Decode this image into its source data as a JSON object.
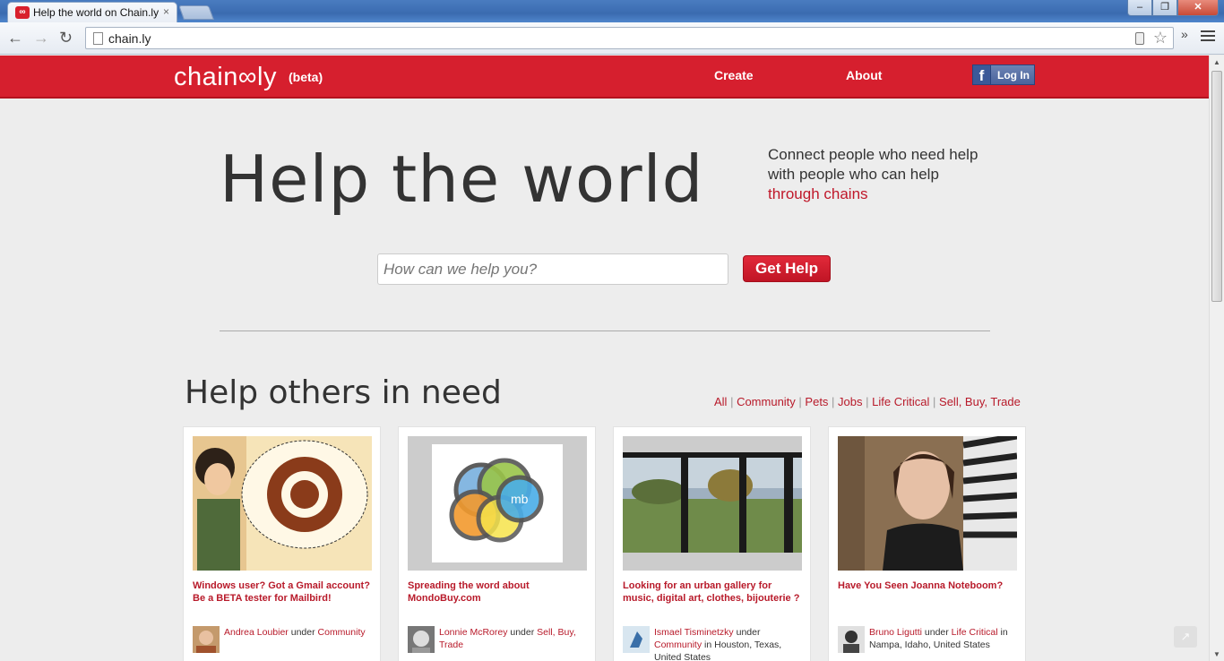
{
  "browser": {
    "tab_title": "Help the world on Chain.ly",
    "tab_favicon_glyph": "∞",
    "url": "chain.ly",
    "close_glyph": "×"
  },
  "header": {
    "logo_text": "chain∞ly",
    "beta": "(beta)",
    "nav": {
      "create": "Create",
      "about": "About"
    },
    "fb_login": "Log In"
  },
  "hero": {
    "title": "Help the world",
    "tagline_line1": "Connect people who need help",
    "tagline_line2": "with people who can help",
    "tagline_accent": "through chains",
    "search_placeholder": "How can we help you?",
    "get_help_label": "Get Help"
  },
  "section": {
    "title": "Help others in need",
    "filters": [
      "All",
      "Community",
      "Pets",
      "Jobs",
      "Life Critical",
      "Sell, Buy, Trade"
    ]
  },
  "cards": [
    {
      "title": "Windows user? Got a Gmail account? Be a BETA tester for Mailbird!",
      "user": "Andrea Loubier",
      "under": "under",
      "category": "Community",
      "location": ""
    },
    {
      "title": "Spreading the word about MondoBuy.com",
      "user": "Lonnie McRorey",
      "under": "under",
      "category": "Sell, Buy, Trade",
      "location": ""
    },
    {
      "title": "Looking for an urban gallery for music, digital art, clothes, bijouterie ?",
      "user": "Ismael Tisminetzky",
      "under": "under",
      "category": "Community",
      "location": "in Houston, Texas, United States"
    },
    {
      "title": "Have You Seen Joanna Noteboom?",
      "user": "Bruno Ligutti",
      "under": "under",
      "category": "Life Critical",
      "location": "in Nampa, Idaho, United States"
    }
  ],
  "icons": {
    "mondobuy_logo_text": "mb"
  },
  "colors": {
    "brand_red": "#d61f2e",
    "link_red": "#b81a2a",
    "facebook_blue": "#3b5998"
  }
}
